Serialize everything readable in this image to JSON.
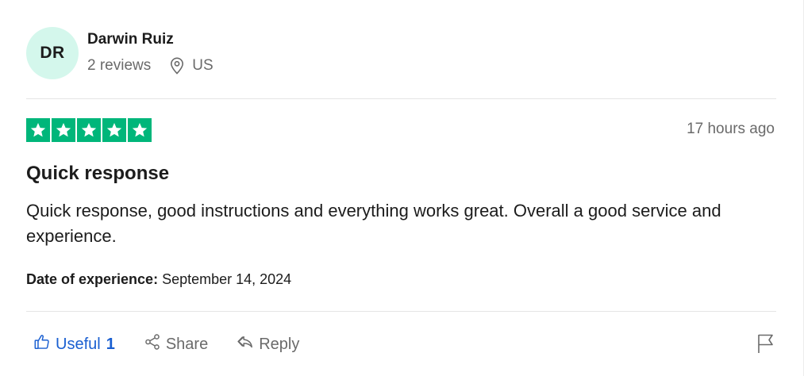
{
  "consumer": {
    "initials": "DR",
    "name": "Darwin Ruiz",
    "reviews_count": "2 reviews",
    "country": "US",
    "location_icon": "location-pin-icon",
    "avatar_color": "#d4f7ec"
  },
  "review": {
    "rating": 5,
    "star_color": "#00b67a",
    "time_ago": "17 hours ago",
    "title": "Quick response",
    "text": "Quick response, good instructions and everything works great. Overall a good service and experience.",
    "date_of_experience_label": "Date of experience:",
    "date_of_experience_value": "September 14, 2024"
  },
  "actions": {
    "useful_label": "Useful",
    "useful_count": "1",
    "share_label": "Share",
    "reply_label": "Reply",
    "useful_icon": "thumbs-up-icon",
    "share_icon": "share-icon",
    "reply_icon": "reply-arrow-icon",
    "flag_icon": "flag-icon",
    "accent_color": "#1a5fd1"
  }
}
